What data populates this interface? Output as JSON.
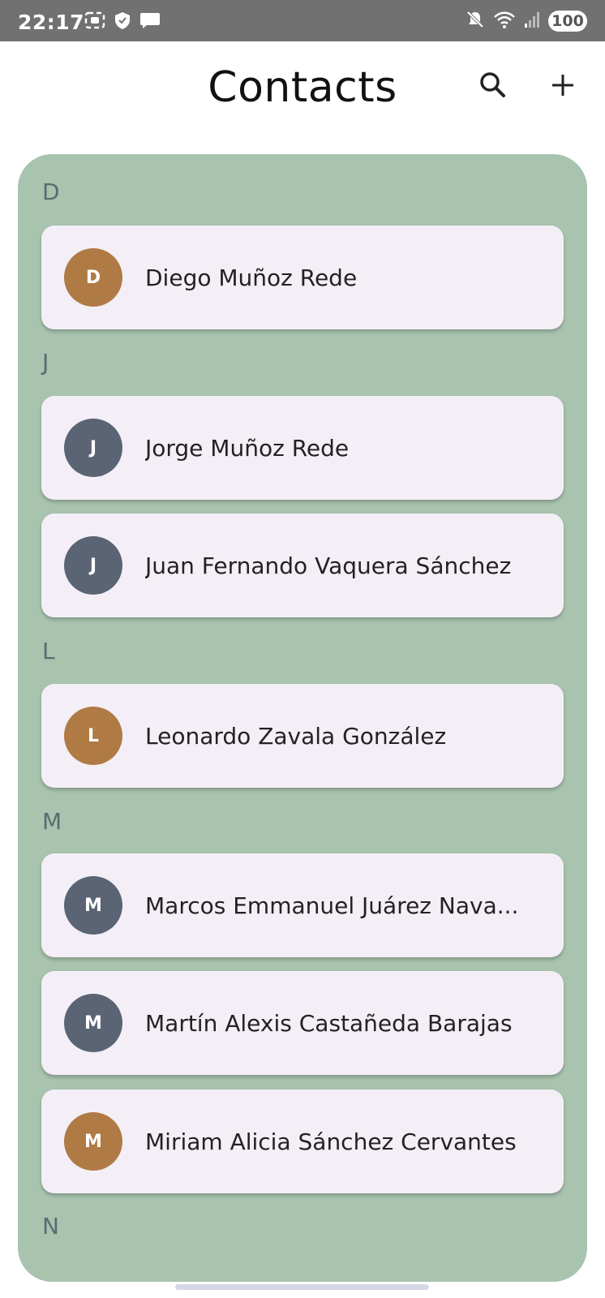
{
  "status_bar": {
    "time": "22:17",
    "battery": "100",
    "left_icons": [
      "screen-record-icon",
      "shield-icon",
      "message-icon"
    ],
    "right_icons": [
      "mute-icon",
      "wifi-icon",
      "signal-icon"
    ]
  },
  "header": {
    "title": "Contacts",
    "search_icon": "search-icon",
    "add_icon": "plus-icon"
  },
  "colors": {
    "status_bar": "#717171",
    "panel": "#a8c3ae",
    "card": "#f4eff6",
    "avatar_brown": "#b07a45",
    "avatar_slate": "#5a6475"
  },
  "sections": [
    {
      "letter": "D",
      "contacts": [
        {
          "initial": "D",
          "name": "Diego Muñoz Rede",
          "avatar_color": "#b07a45"
        }
      ]
    },
    {
      "letter": "J",
      "contacts": [
        {
          "initial": "J",
          "name": "Jorge Muñoz Rede",
          "avatar_color": "#5a6475"
        },
        {
          "initial": "J",
          "name": "Juan Fernando Vaquera Sánchez",
          "avatar_color": "#5a6475"
        }
      ]
    },
    {
      "letter": "L",
      "contacts": [
        {
          "initial": "L",
          "name": "Leonardo Zavala González",
          "avatar_color": "#b07a45"
        }
      ]
    },
    {
      "letter": "M",
      "contacts": [
        {
          "initial": "M",
          "name": "Marcos Emmanuel Juárez Nava...",
          "avatar_color": "#5a6475"
        },
        {
          "initial": "M",
          "name": "Martín Alexis Castañeda Barajas",
          "avatar_color": "#5a6475"
        },
        {
          "initial": "M",
          "name": "Miriam Alicia Sánchez Cervantes",
          "avatar_color": "#b07a45"
        }
      ]
    },
    {
      "letter": "N",
      "contacts": []
    }
  ]
}
